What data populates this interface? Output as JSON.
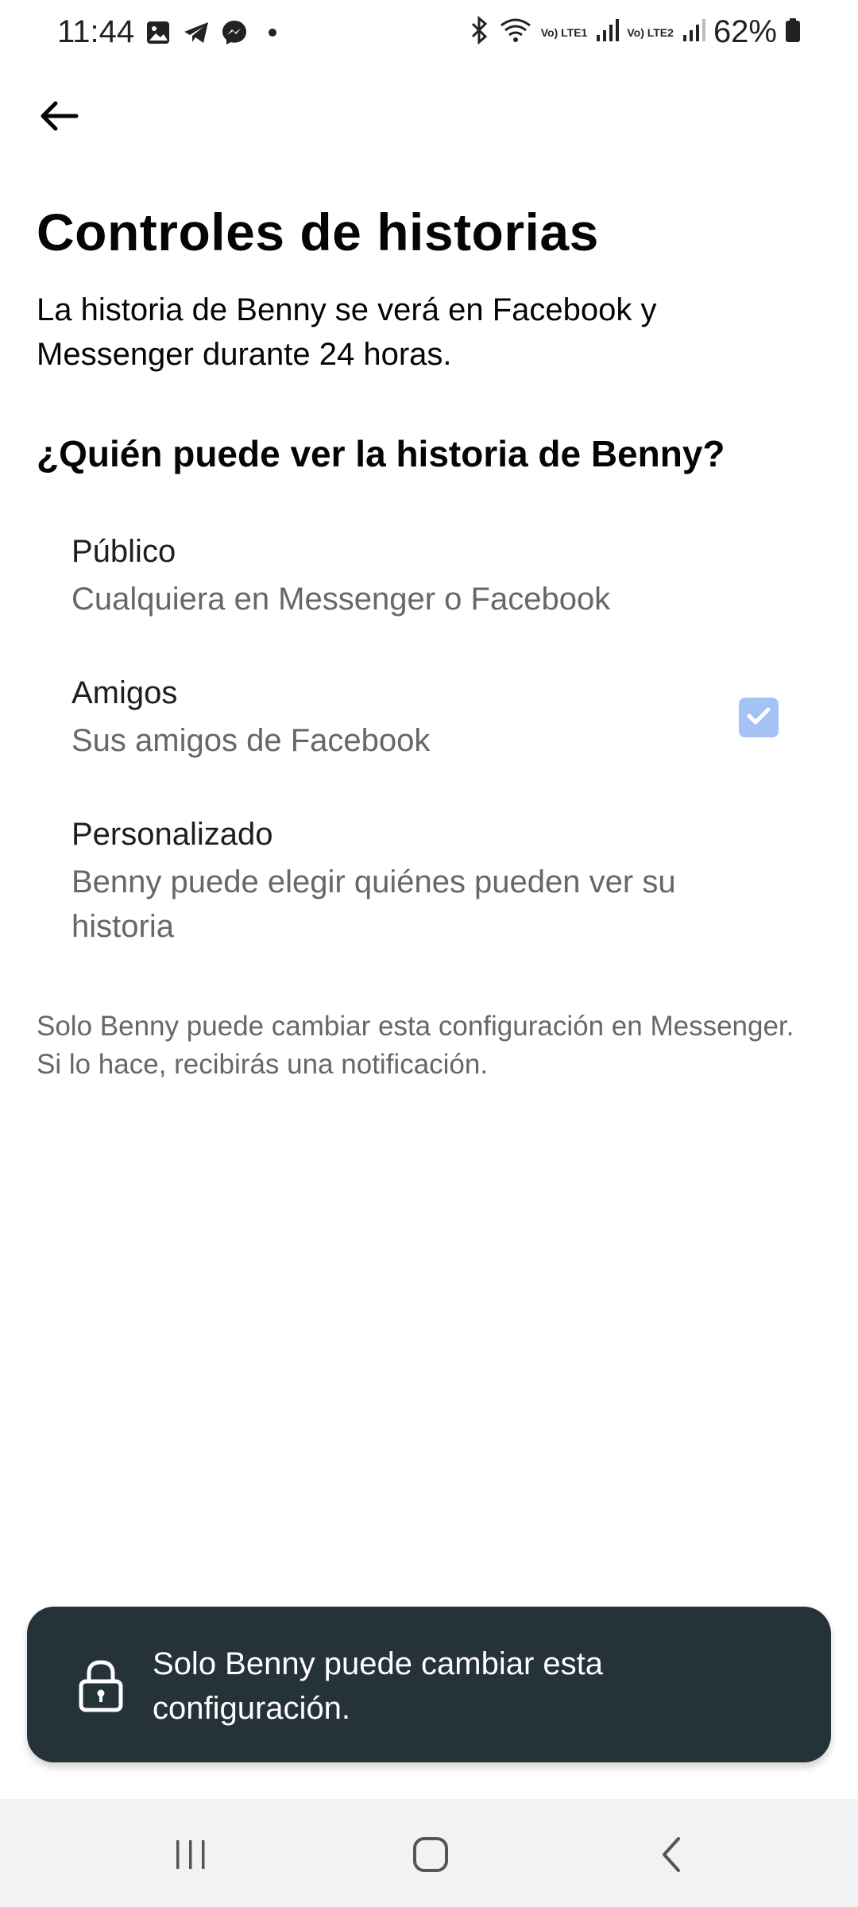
{
  "status_bar": {
    "time": "11:44",
    "battery_percent": "62%",
    "sim1_label": "Vo) LTE1",
    "sim2_label": "Vo) LTE2",
    "icons": [
      "gallery-icon",
      "telegram-icon",
      "messenger-icon",
      "dot-icon",
      "bluetooth-icon",
      "wifi-icon",
      "signal-icon",
      "battery-icon"
    ]
  },
  "header": {
    "back_icon": "back-arrow-icon",
    "title": "Controles de historias",
    "description": "La historia de Benny se verá en Facebook y Messenger durante 24 horas."
  },
  "audience": {
    "heading": "¿Quién puede ver la historia de Benny?",
    "options": [
      {
        "title": "Público",
        "subtitle": "Cualquiera en Messenger o Facebook",
        "selected": false
      },
      {
        "title": "Amigos",
        "subtitle": "Sus amigos de Facebook",
        "selected": true
      },
      {
        "title": "Personalizado",
        "subtitle": "Benny puede elegir quiénes pueden ver su historia",
        "selected": false
      }
    ]
  },
  "footnote": "Solo Benny puede cambiar esta configuración en Messenger. Si lo hace, recibirás una notificación.",
  "toast": {
    "icon": "lock-icon",
    "text": "Solo Benny puede cambiar esta configuración."
  },
  "colors": {
    "checkbox_fill": "#a4c2f4",
    "toast_bg": "#25323a",
    "secondary_text": "#65676b"
  },
  "nav_bar": {
    "icons": [
      "recent-apps-icon",
      "home-icon",
      "back-icon"
    ]
  }
}
